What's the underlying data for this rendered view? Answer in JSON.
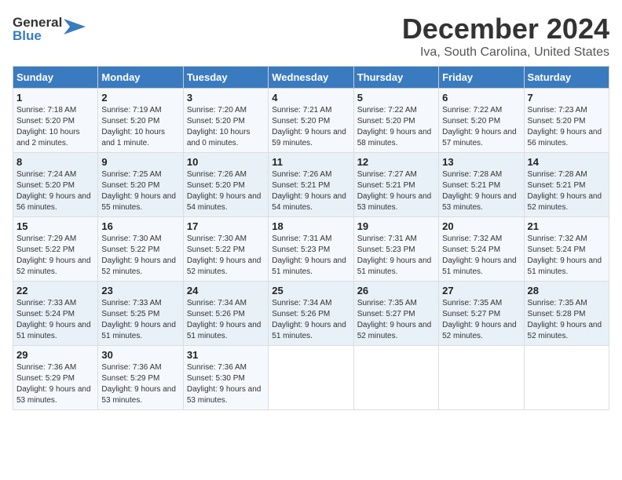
{
  "logo": {
    "general": "General",
    "blue": "Blue",
    "icon": "▶"
  },
  "title": "December 2024",
  "location": "Iva, South Carolina, United States",
  "days_of_week": [
    "Sunday",
    "Monday",
    "Tuesday",
    "Wednesday",
    "Thursday",
    "Friday",
    "Saturday"
  ],
  "weeks": [
    [
      {
        "day": "1",
        "sunrise": "Sunrise: 7:18 AM",
        "sunset": "Sunset: 5:20 PM",
        "daylight": "Daylight: 10 hours and 2 minutes."
      },
      {
        "day": "2",
        "sunrise": "Sunrise: 7:19 AM",
        "sunset": "Sunset: 5:20 PM",
        "daylight": "Daylight: 10 hours and 1 minute."
      },
      {
        "day": "3",
        "sunrise": "Sunrise: 7:20 AM",
        "sunset": "Sunset: 5:20 PM",
        "daylight": "Daylight: 10 hours and 0 minutes."
      },
      {
        "day": "4",
        "sunrise": "Sunrise: 7:21 AM",
        "sunset": "Sunset: 5:20 PM",
        "daylight": "Daylight: 9 hours and 59 minutes."
      },
      {
        "day": "5",
        "sunrise": "Sunrise: 7:22 AM",
        "sunset": "Sunset: 5:20 PM",
        "daylight": "Daylight: 9 hours and 58 minutes."
      },
      {
        "day": "6",
        "sunrise": "Sunrise: 7:22 AM",
        "sunset": "Sunset: 5:20 PM",
        "daylight": "Daylight: 9 hours and 57 minutes."
      },
      {
        "day": "7",
        "sunrise": "Sunrise: 7:23 AM",
        "sunset": "Sunset: 5:20 PM",
        "daylight": "Daylight: 9 hours and 56 minutes."
      }
    ],
    [
      {
        "day": "8",
        "sunrise": "Sunrise: 7:24 AM",
        "sunset": "Sunset: 5:20 PM",
        "daylight": "Daylight: 9 hours and 56 minutes."
      },
      {
        "day": "9",
        "sunrise": "Sunrise: 7:25 AM",
        "sunset": "Sunset: 5:20 PM",
        "daylight": "Daylight: 9 hours and 55 minutes."
      },
      {
        "day": "10",
        "sunrise": "Sunrise: 7:26 AM",
        "sunset": "Sunset: 5:20 PM",
        "daylight": "Daylight: 9 hours and 54 minutes."
      },
      {
        "day": "11",
        "sunrise": "Sunrise: 7:26 AM",
        "sunset": "Sunset: 5:21 PM",
        "daylight": "Daylight: 9 hours and 54 minutes."
      },
      {
        "day": "12",
        "sunrise": "Sunrise: 7:27 AM",
        "sunset": "Sunset: 5:21 PM",
        "daylight": "Daylight: 9 hours and 53 minutes."
      },
      {
        "day": "13",
        "sunrise": "Sunrise: 7:28 AM",
        "sunset": "Sunset: 5:21 PM",
        "daylight": "Daylight: 9 hours and 53 minutes."
      },
      {
        "day": "14",
        "sunrise": "Sunrise: 7:28 AM",
        "sunset": "Sunset: 5:21 PM",
        "daylight": "Daylight: 9 hours and 52 minutes."
      }
    ],
    [
      {
        "day": "15",
        "sunrise": "Sunrise: 7:29 AM",
        "sunset": "Sunset: 5:22 PM",
        "daylight": "Daylight: 9 hours and 52 minutes."
      },
      {
        "day": "16",
        "sunrise": "Sunrise: 7:30 AM",
        "sunset": "Sunset: 5:22 PM",
        "daylight": "Daylight: 9 hours and 52 minutes."
      },
      {
        "day": "17",
        "sunrise": "Sunrise: 7:30 AM",
        "sunset": "Sunset: 5:22 PM",
        "daylight": "Daylight: 9 hours and 52 minutes."
      },
      {
        "day": "18",
        "sunrise": "Sunrise: 7:31 AM",
        "sunset": "Sunset: 5:23 PM",
        "daylight": "Daylight: 9 hours and 51 minutes."
      },
      {
        "day": "19",
        "sunrise": "Sunrise: 7:31 AM",
        "sunset": "Sunset: 5:23 PM",
        "daylight": "Daylight: 9 hours and 51 minutes."
      },
      {
        "day": "20",
        "sunrise": "Sunrise: 7:32 AM",
        "sunset": "Sunset: 5:24 PM",
        "daylight": "Daylight: 9 hours and 51 minutes."
      },
      {
        "day": "21",
        "sunrise": "Sunrise: 7:32 AM",
        "sunset": "Sunset: 5:24 PM",
        "daylight": "Daylight: 9 hours and 51 minutes."
      }
    ],
    [
      {
        "day": "22",
        "sunrise": "Sunrise: 7:33 AM",
        "sunset": "Sunset: 5:24 PM",
        "daylight": "Daylight: 9 hours and 51 minutes."
      },
      {
        "day": "23",
        "sunrise": "Sunrise: 7:33 AM",
        "sunset": "Sunset: 5:25 PM",
        "daylight": "Daylight: 9 hours and 51 minutes."
      },
      {
        "day": "24",
        "sunrise": "Sunrise: 7:34 AM",
        "sunset": "Sunset: 5:26 PM",
        "daylight": "Daylight: 9 hours and 51 minutes."
      },
      {
        "day": "25",
        "sunrise": "Sunrise: 7:34 AM",
        "sunset": "Sunset: 5:26 PM",
        "daylight": "Daylight: 9 hours and 51 minutes."
      },
      {
        "day": "26",
        "sunrise": "Sunrise: 7:35 AM",
        "sunset": "Sunset: 5:27 PM",
        "daylight": "Daylight: 9 hours and 52 minutes."
      },
      {
        "day": "27",
        "sunrise": "Sunrise: 7:35 AM",
        "sunset": "Sunset: 5:27 PM",
        "daylight": "Daylight: 9 hours and 52 minutes."
      },
      {
        "day": "28",
        "sunrise": "Sunrise: 7:35 AM",
        "sunset": "Sunset: 5:28 PM",
        "daylight": "Daylight: 9 hours and 52 minutes."
      }
    ],
    [
      {
        "day": "29",
        "sunrise": "Sunrise: 7:36 AM",
        "sunset": "Sunset: 5:29 PM",
        "daylight": "Daylight: 9 hours and 53 minutes."
      },
      {
        "day": "30",
        "sunrise": "Sunrise: 7:36 AM",
        "sunset": "Sunset: 5:29 PM",
        "daylight": "Daylight: 9 hours and 53 minutes."
      },
      {
        "day": "31",
        "sunrise": "Sunrise: 7:36 AM",
        "sunset": "Sunset: 5:30 PM",
        "daylight": "Daylight: 9 hours and 53 minutes."
      },
      null,
      null,
      null,
      null
    ]
  ]
}
